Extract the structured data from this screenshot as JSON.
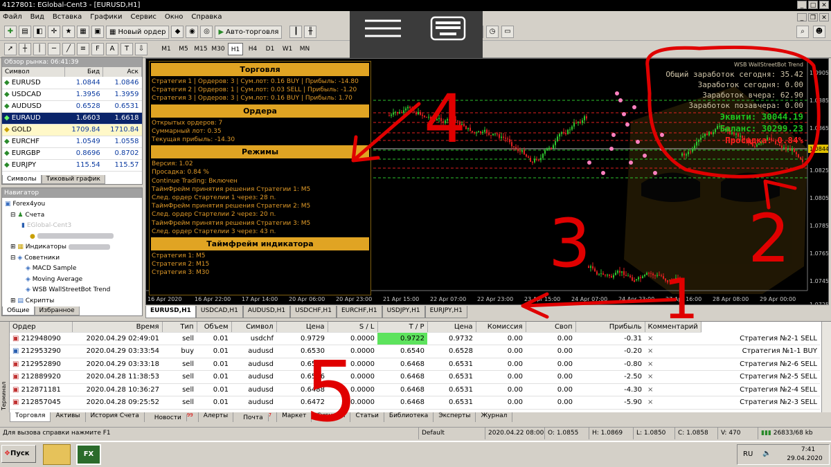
{
  "window": {
    "title": "4127801: EGlobal-Cent3 - [EURUSD,H1]"
  },
  "menu": [
    "Файл",
    "Вид",
    "Вставка",
    "Графики",
    "Сервис",
    "Окно",
    "Справка"
  ],
  "toolbar": {
    "new_order": "Новый ордер",
    "autotrade": "Авто-торговля"
  },
  "timeframes": [
    "M1",
    "M5",
    "M15",
    "M30",
    "H1",
    "H4",
    "D1",
    "W1",
    "MN"
  ],
  "timeframe_active": "H1",
  "market_watch": {
    "header": "Обзор рынка: 06:41:39",
    "col_symbol": "Символ",
    "col_bid": "Бид",
    "col_ask": "Аск",
    "rows": [
      {
        "s": "EURUSD",
        "b": "1.0844",
        "a": "1.0846"
      },
      {
        "s": "USDCAD",
        "b": "1.3956",
        "a": "1.3959"
      },
      {
        "s": "AUDUSD",
        "b": "0.6528",
        "a": "0.6531"
      },
      {
        "s": "EURAUD",
        "b": "1.6603",
        "a": "1.6618"
      },
      {
        "s": "GOLD",
        "b": "1709.84",
        "a": "1710.84"
      },
      {
        "s": "EURCHF",
        "b": "1.0549",
        "a": "1.0558"
      },
      {
        "s": "EURGBP",
        "b": "0.8696",
        "a": "0.8702"
      },
      {
        "s": "EURJPY",
        "b": "115.54",
        "a": "115.57"
      }
    ],
    "tabs": [
      "Символы",
      "Тиковый график"
    ]
  },
  "navigator": {
    "header": "Навигатор",
    "items": [
      "Forex4you",
      "Счета",
      "EGlobal-Cent3",
      "Индикаторы",
      "Советники",
      "MACD Sample",
      "Moving Average",
      "WSB WallStreetBot Trend",
      "Скрипты"
    ],
    "tabs": [
      "Общие",
      "Избранное"
    ]
  },
  "info": {
    "s1": "Торговля",
    "t1": "Стратегия 1 | Ордеров: 3 | Сум.лот: 0.16 BUY | Прибыль: -14.80",
    "t2": "Стратегия 2 | Ордеров: 1 | Сум.лот: 0.03 SELL | Прибыль: -1.20",
    "t3": "Стратегия 3 | Ордеров: 3 | Сум.лот: 0.16 BUY | Прибыль: 1.70",
    "s2": "Ордера",
    "o1": "Открытых ордеров: 7",
    "o2": "Суммарный лот: 0.35",
    "o3": "Текущая прибыль: -14.30",
    "s3": "Режимы",
    "r1": "Версия: 1.02",
    "r2": "Просадка: 0.84 %",
    "r3": "Continue Trading: Включен",
    "r4": "ТаймФрейм принятия решения Стратегии 1: M5",
    "r5": "След. ордер Стартелии 1 через: 28 п.",
    "r6": "ТаймФрейм принятия решения Стратегии 2: M5",
    "r7": "След. ордер Стартелии 2 через: 20 п.",
    "r8": "ТаймФрейм принятия решения Стратегии 3: M5",
    "r9": "След. ордер Стартелии 3 через: 43 п.",
    "s4": "Таймфрейм индикатора",
    "f1": "Стратегия 1: M5",
    "f2": "Стратегия 2: M15",
    "f3": "Стратегия 3: M30"
  },
  "stats": {
    "name": "WSB WallStreetBot Trend",
    "l1": "Общий заработок сегодня: 35.42",
    "l2": "Заработок сегодня: 0.00",
    "l3": "Заработок вчера: 62.90",
    "l4": "Заработок позавчера: 0.00",
    "equity": "Эквити: 30044.19",
    "balance": "Баланс: 30299.23",
    "drawdown": "Просадка: 0.84%"
  },
  "price_axis": [
    "1.0905",
    "1.0885",
    "1.0865",
    "1.0844",
    "1.0825",
    "1.0805",
    "1.0785",
    "1.0765",
    "1.0745",
    "1.0725"
  ],
  "time_axis": [
    "16 Apr 2020",
    "16 Apr 22:00",
    "17 Apr 14:00",
    "20 Apr 06:00",
    "20 Apr 23:00",
    "21 Apr 15:00",
    "22 Apr 07:00",
    "22 Apr 23:00",
    "23 Apr 15:00",
    "24 Apr 07:00",
    "24 Apr 23:00",
    "27 Apr 16:00",
    "28 Apr 08:00",
    "29 Apr 00:00"
  ],
  "chart_tabs": [
    "EURUSD,H1",
    "USDCAD,H1",
    "AUDUSD,H1",
    "USDCHF,H1",
    "EURCHF,H1",
    "USDJPY,H1",
    "EURJPY,H1"
  ],
  "orders": {
    "cols": [
      "Ордер",
      "Время",
      "Тип",
      "Объем",
      "Символ",
      "Цена",
      "S / L",
      "T / P",
      "Цена",
      "Комиссия",
      "Своп",
      "Прибыль",
      "Комментарий"
    ],
    "rows": [
      [
        "212948090",
        "2020.04.29 02:49:01",
        "sell",
        "0.01",
        "usdchf",
        "0.9729",
        "0.0000",
        "0.9722",
        "0.9732",
        "0.00",
        "0.00",
        "-0.31",
        "Стратегия №2-1 SELL"
      ],
      [
        "212953290",
        "2020.04.29 03:33:54",
        "buy",
        "0.01",
        "audusd",
        "0.6530",
        "0.0000",
        "0.6540",
        "0.6528",
        "0.00",
        "0.00",
        "-0.20",
        "Стратегия №1-1 BUY"
      ],
      [
        "212952890",
        "2020.04.29 03:33:18",
        "sell",
        "0.01",
        "audusd",
        "0.6531",
        "0.0000",
        "0.6468",
        "0.6531",
        "0.00",
        "0.00",
        "-0.80",
        "Стратегия №2-6 SELL"
      ],
      [
        "212889920",
        "2020.04.28 11:38:53",
        "sell",
        "0.01",
        "audusd",
        "0.6506",
        "0.0000",
        "0.6468",
        "0.6531",
        "0.00",
        "0.00",
        "-2.50",
        "Стратегия №2-5 SELL"
      ],
      [
        "212871181",
        "2020.04.28 10:36:27",
        "sell",
        "0.01",
        "audusd",
        "0.6488",
        "0.0000",
        "0.6468",
        "0.6531",
        "0.00",
        "0.00",
        "-4.30",
        "Стратегия №2-4 SELL"
      ],
      [
        "212857045",
        "2020.04.28 09:25:52",
        "sell",
        "0.01",
        "audusd",
        "0.6472",
        "0.0000",
        "0.6468",
        "0.6531",
        "0.00",
        "0.00",
        "-5.90",
        "Стратегия №2-3 SELL"
      ]
    ]
  },
  "bottom_tabs": [
    "Торговля",
    "Активы",
    "История Счета",
    "Новости",
    "Алерты",
    "Почта",
    "Маркет",
    "Сигналы",
    "Статьи",
    "Библиотека",
    "Эксперты",
    "Журнал"
  ],
  "news_badge": "99",
  "mail_badge": "7",
  "terminal_label": "Терминал",
  "statusbar": {
    "help": "Для вызова справки нажмите F1",
    "profile": "Default",
    "time": "2020.04.22 08:00",
    "o": "O: 1.0855",
    "h": "H: 1.0869",
    "l": "L: 1.0850",
    "c": "C: 1.0858",
    "v": "V: 470",
    "traffic": "26833/68 kb"
  },
  "taskbar": {
    "start": "Пуск",
    "lang": "RU",
    "clock": "7:41",
    "date": "29.04.2020"
  },
  "annotations": [
    "4",
    "3",
    "2",
    "1",
    "5"
  ]
}
